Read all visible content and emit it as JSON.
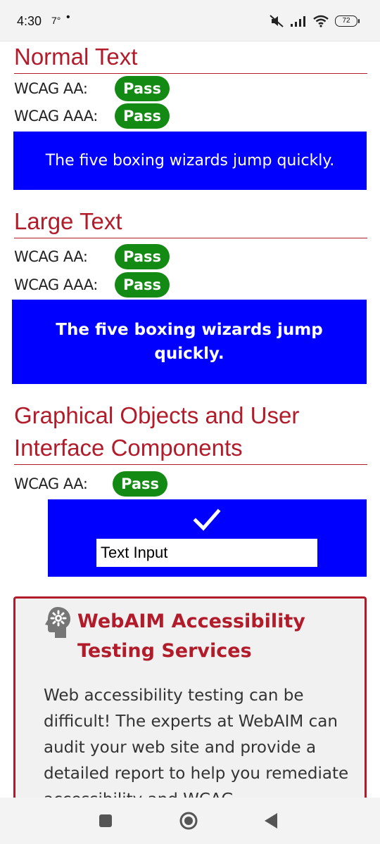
{
  "status_bar": {
    "time": "4:30",
    "temp": "7°",
    "dot": "•",
    "battery": "72"
  },
  "sections": {
    "normal": {
      "title": "Normal Text",
      "aa_label": "WCAG AA:",
      "aa_result": "Pass",
      "aaa_label": "WCAG AAA:",
      "aaa_result": "Pass",
      "sample": "The five boxing wizards jump quickly."
    },
    "large": {
      "title": "Large Text",
      "aa_label": "WCAG AA:",
      "aa_result": "Pass",
      "aaa_label": "WCAG AAA:",
      "aaa_result": "Pass",
      "sample": "The five boxing wizards jump quickly."
    },
    "graphical": {
      "title": "Graphical Objects and User Interface Components",
      "aa_label": "WCAG AA:",
      "aa_result": "Pass",
      "input_value": "Text Input"
    }
  },
  "promo": {
    "title": "WebAIM Accessibility Testing Services",
    "body": "Web accessibility testing can be difficult! The experts at WebAIM can audit your web site and provide a detailed report to help you remediate accessibility and WCAG"
  },
  "colors": {
    "heading": "#b21c2a",
    "pass_badge": "#138a13",
    "sample_bg": "#0000ff",
    "sample_fg": "#ffffff"
  },
  "icons": {
    "status": [
      "mute-icon",
      "signal-icon",
      "wifi-icon",
      "battery-icon"
    ],
    "nav": [
      "recents-button-icon",
      "home-button-icon",
      "back-button-icon"
    ],
    "promo": "gear-head-icon",
    "ui_sample": "checkmark-icon"
  }
}
